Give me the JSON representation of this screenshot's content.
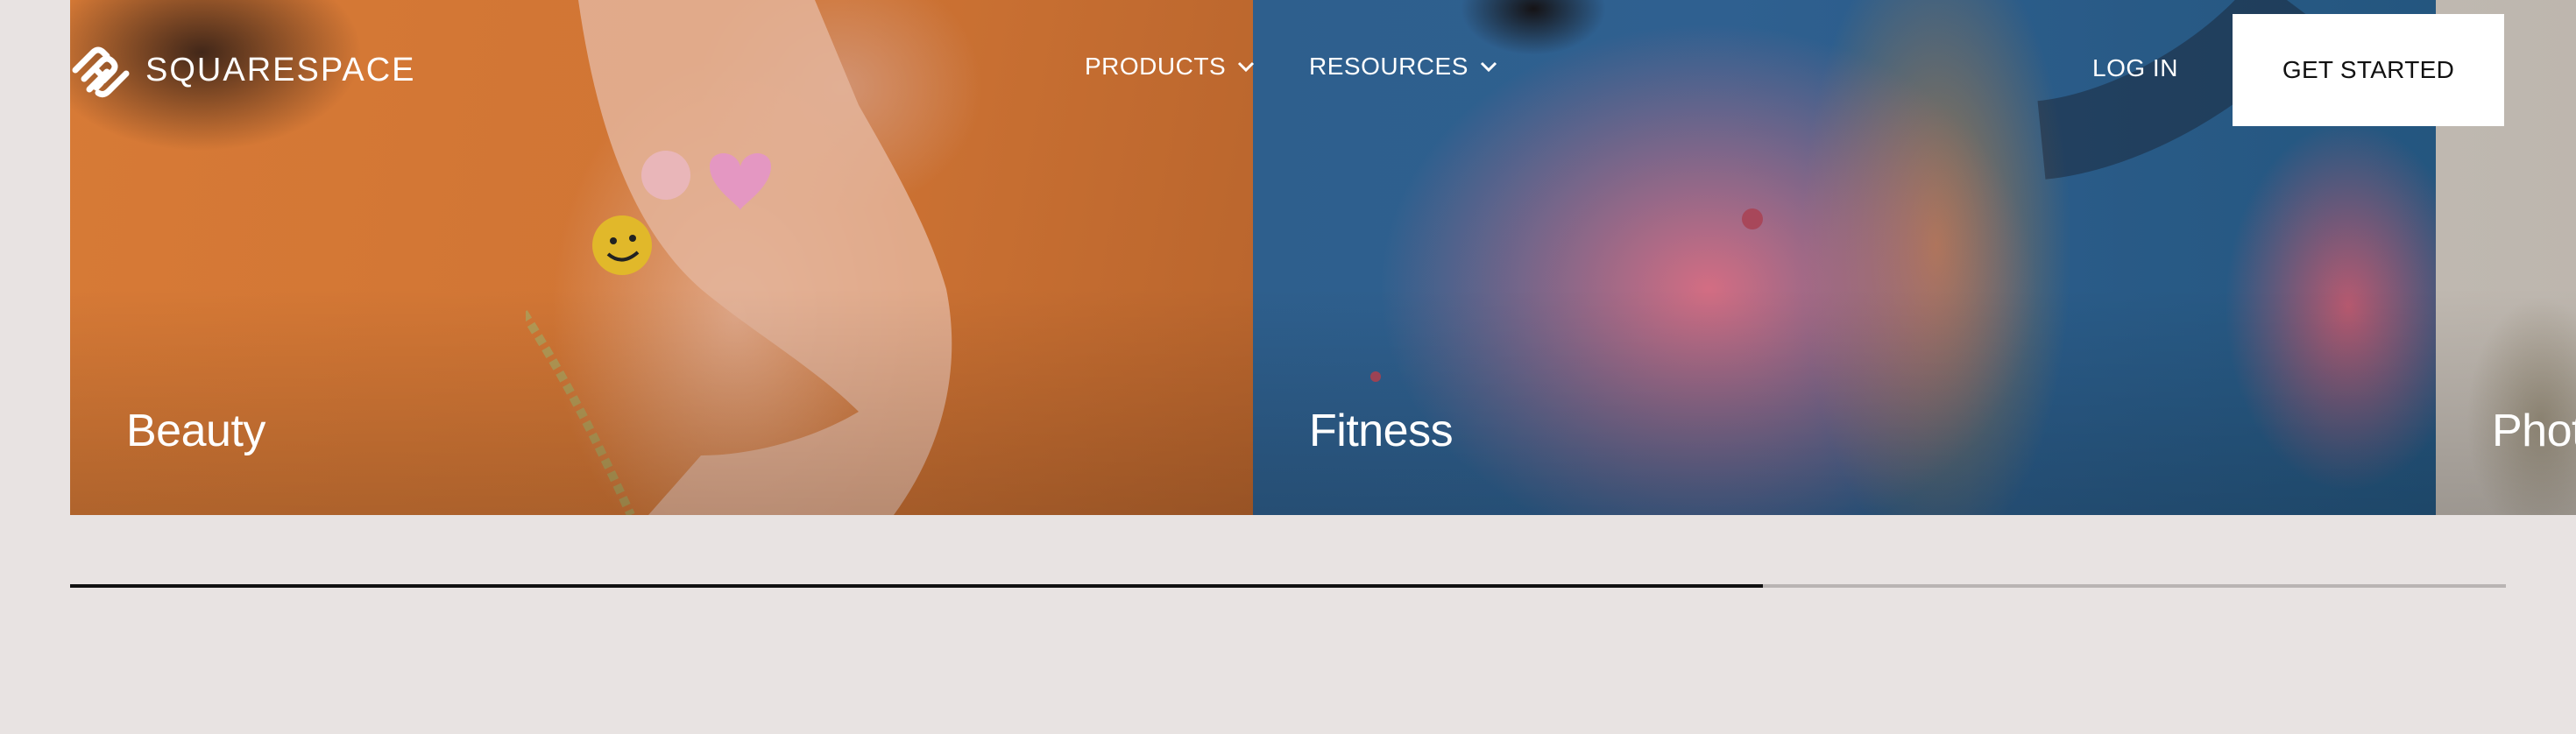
{
  "header": {
    "brand": "SQUARESPACE",
    "nav": {
      "products_label": "PRODUCTS",
      "resources_label": "RESOURCES"
    },
    "login_label": "LOG IN",
    "cta_label": "GET STARTED"
  },
  "carousel": {
    "cards": [
      {
        "title": "Beauty",
        "bg": "#d77a36"
      },
      {
        "title": "Fitness",
        "bg": "#2f6090"
      },
      {
        "title": "Phot",
        "bg": "#bfb8b0"
      }
    ],
    "progress": 0.695
  },
  "colors": {
    "page_bg": "#e8e3e2",
    "progress_track": "#b9b4b3",
    "progress_fill": "#111111",
    "cta_bg": "#ffffff"
  },
  "icons": {
    "logo": "squarespace-logo-icon",
    "dropdown": "chevron-down-icon"
  }
}
